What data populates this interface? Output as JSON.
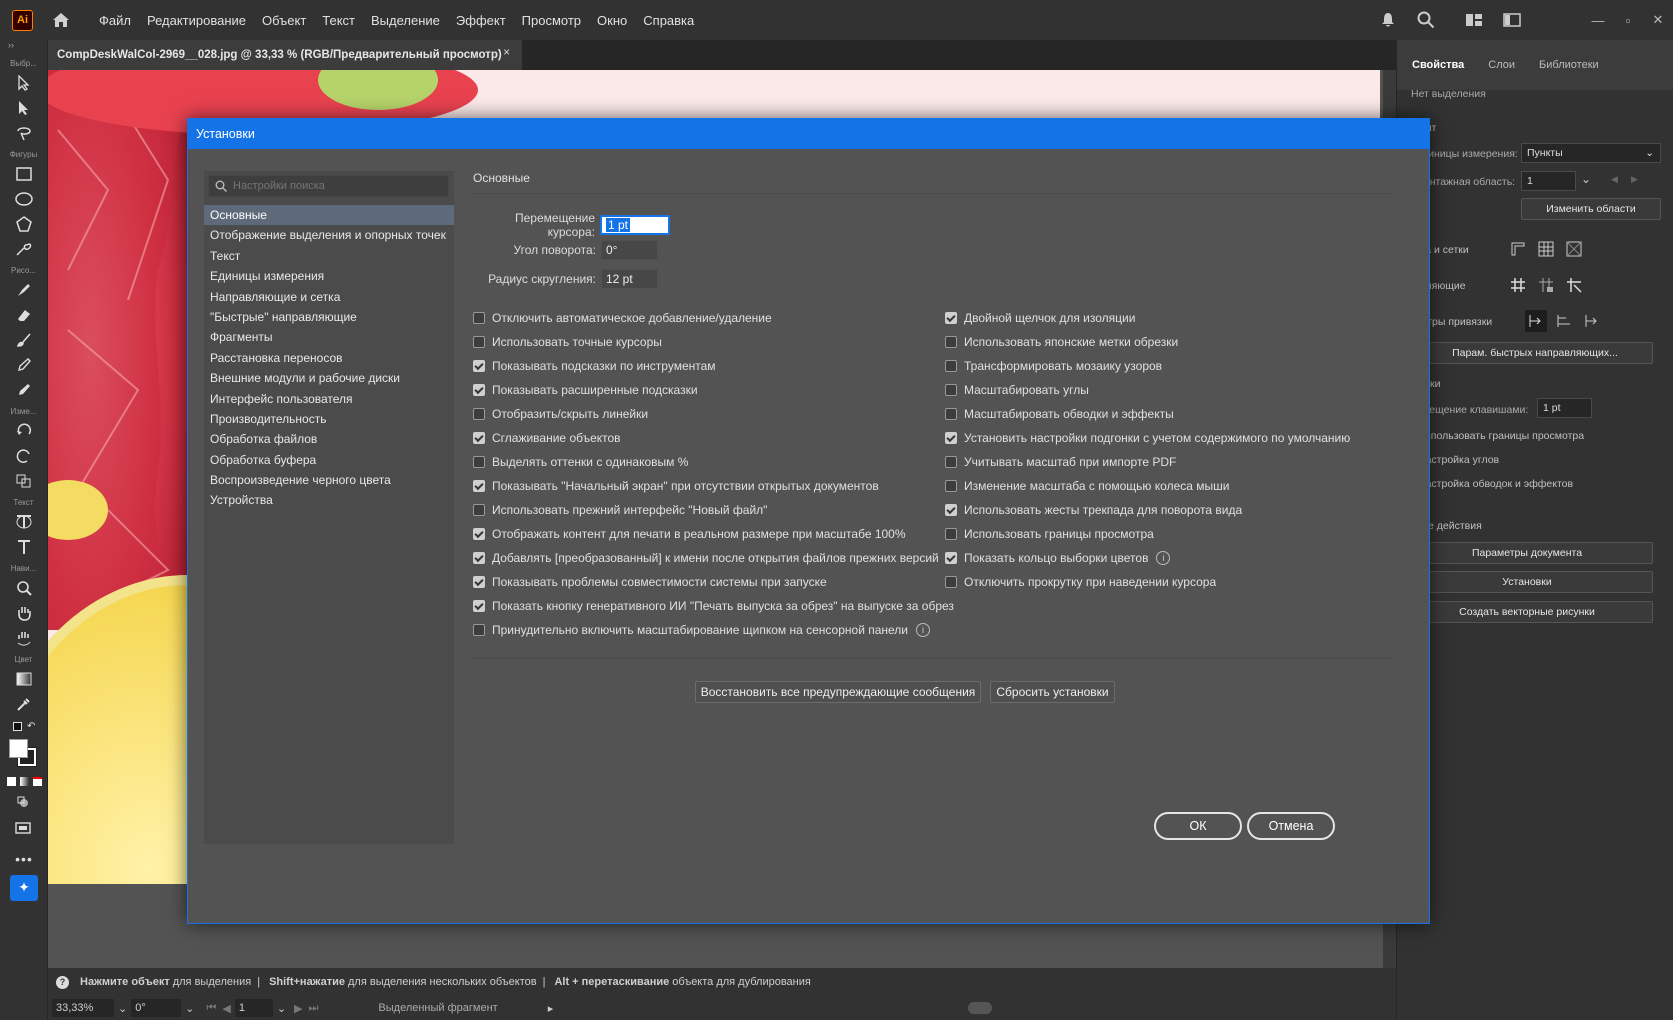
{
  "app": {
    "logo": "Ai"
  },
  "menu": [
    "Файл",
    "Редактирование",
    "Объект",
    "Текст",
    "Выделение",
    "Эффект",
    "Просмотр",
    "Окно",
    "Справка"
  ],
  "doc_tab": {
    "title": "CompDeskWalCol-2969__028.jpg @ 33,33 % (RGB/Предварительный просмотр)",
    "close": "×"
  },
  "toolbar_groups": {
    "select": "Выбр...",
    "shapes": "Фигуры",
    "draw": "Рисо...",
    "modify": "Изме...",
    "text": "Текст",
    "nav": "Нави...",
    "color": "Цвет"
  },
  "status": {
    "hint_bold1": "Нажмите объект",
    "hint1": "для выделения",
    "hint_bold2": "Shift+нажатие",
    "hint2": "для выделения нескольких объектов",
    "hint_bold3": "Alt + перетаскивание",
    "hint3": "объекта для дублирования",
    "zoom": "33,33%",
    "angle": "0°",
    "artboard": "1",
    "selection": "Выделенный фрагмент"
  },
  "right_panel": {
    "tabs": [
      "Свойства",
      "Слои",
      "Библиотеки"
    ],
    "no_selection": "Нет выделения",
    "document": "окумент",
    "units_label": "Единицы измерения:",
    "units_value": "Пункты",
    "artboard_label": "Монтажная область:",
    "artboard_value": "1",
    "edit_artboards": "Изменить области",
    "rulers": "инейка и сетки",
    "guides": "аправляющие",
    "snap": "араметры привязки",
    "smart_guides_btn": "Парам. быстрых направляющих...",
    "prefs": "становки",
    "key_increment_label": "Перемещение клавишами:",
    "key_increment_value": "1 pt",
    "checks": [
      "Использовать границы просмотра",
      "Настройка углов",
      "Настройка обводок и эффектов"
    ],
    "quick_actions": "ыстрые действия",
    "buttons": [
      "Параметры документа",
      "Установки",
      "Создать векторные рисунки"
    ]
  },
  "dialog": {
    "title": "Установки",
    "search_placeholder": "Настройки поиска",
    "nav": [
      "Основные",
      "Отображение выделения и опорных точек",
      "Текст",
      "Единицы измерения",
      "Направляющие и сетка",
      "\"Быстрые\" направляющие",
      "Фрагменты",
      "Расстановка переносов",
      "Внешние модули и рабочие диски",
      "Интерфейс пользователя",
      "Производительность",
      "Обработка файлов",
      "Обработка буфера",
      "Воспроизведение черного цвета",
      "Устройства"
    ],
    "section": "Основные",
    "fields": {
      "cursor_label": "Перемещение курсора:",
      "cursor_value": "1 pt",
      "angle_label": "Угол поворота:",
      "angle_value": "0°",
      "radius_label": "Радиус скругления:",
      "radius_value": "12 pt"
    },
    "left_checks": [
      {
        "label": "Отключить автоматическое добавление/удаление",
        "checked": false
      },
      {
        "label": "Использовать точные курсоры",
        "checked": false
      },
      {
        "label": "Показывать подсказки по инструментам",
        "checked": true
      },
      {
        "label": "Показывать расширенные подсказки",
        "checked": true
      },
      {
        "label": "Отобразить/скрыть линейки",
        "checked": false
      },
      {
        "label": "Сглаживание объектов",
        "checked": true
      },
      {
        "label": "Выделять оттенки с одинаковым %",
        "checked": false
      },
      {
        "label": "Показывать \"Начальный экран\" при отсутствии открытых документов",
        "checked": true
      },
      {
        "label": "Использовать прежний интерфейс \"Новый файл\"",
        "checked": false
      },
      {
        "label": "Отображать контент для печати в реальном размере при масштабе 100%",
        "checked": true
      },
      {
        "label": "Добавлять [преобразованный] к имени после открытия файлов прежних версий",
        "checked": true
      },
      {
        "label": "Показывать проблемы совместимости системы при запуске",
        "checked": true
      },
      {
        "label": "Показать кнопку генеративного ИИ \"Печать выпуска за обрез\" на выпуске за обрез",
        "checked": true
      },
      {
        "label": "Принудительно включить масштабирование щипком на сенсорной панели",
        "checked": false
      }
    ],
    "right_checks": [
      {
        "label": "Двойной щелчок для изоляции",
        "checked": true
      },
      {
        "label": "Использовать японские метки обрезки",
        "checked": false
      },
      {
        "label": "Трансформировать мозаику узоров",
        "checked": false
      },
      {
        "label": "Масштабировать углы",
        "checked": false
      },
      {
        "label": "Масштабировать обводки и эффекты",
        "checked": false
      },
      {
        "label": "Установить настройки подгонки с учетом содержимого по умолчанию",
        "checked": true
      },
      {
        "label": "Учитывать масштаб при импорте PDF",
        "checked": false
      },
      {
        "label": "Изменение масштаба с помощью колеса мыши",
        "checked": false
      },
      {
        "label": "Использовать жесты трекпада для поворота вида",
        "checked": true
      },
      {
        "label": "Использовать границы просмотра",
        "checked": false
      },
      {
        "label": "Показать кольцо выборки цветов",
        "checked": true
      },
      {
        "label": "Отключить прокрутку при наведении курсора",
        "checked": false
      }
    ],
    "info_icon": "i",
    "restore_btn": "Восстановить все предупреждающие сообщения",
    "reset_btn": "Сбросить установки",
    "ok": "ОК",
    "cancel": "Отмена"
  },
  "colors": {
    "accent": "#1473e6",
    "panel": "#323232",
    "dialog": "#535353"
  }
}
